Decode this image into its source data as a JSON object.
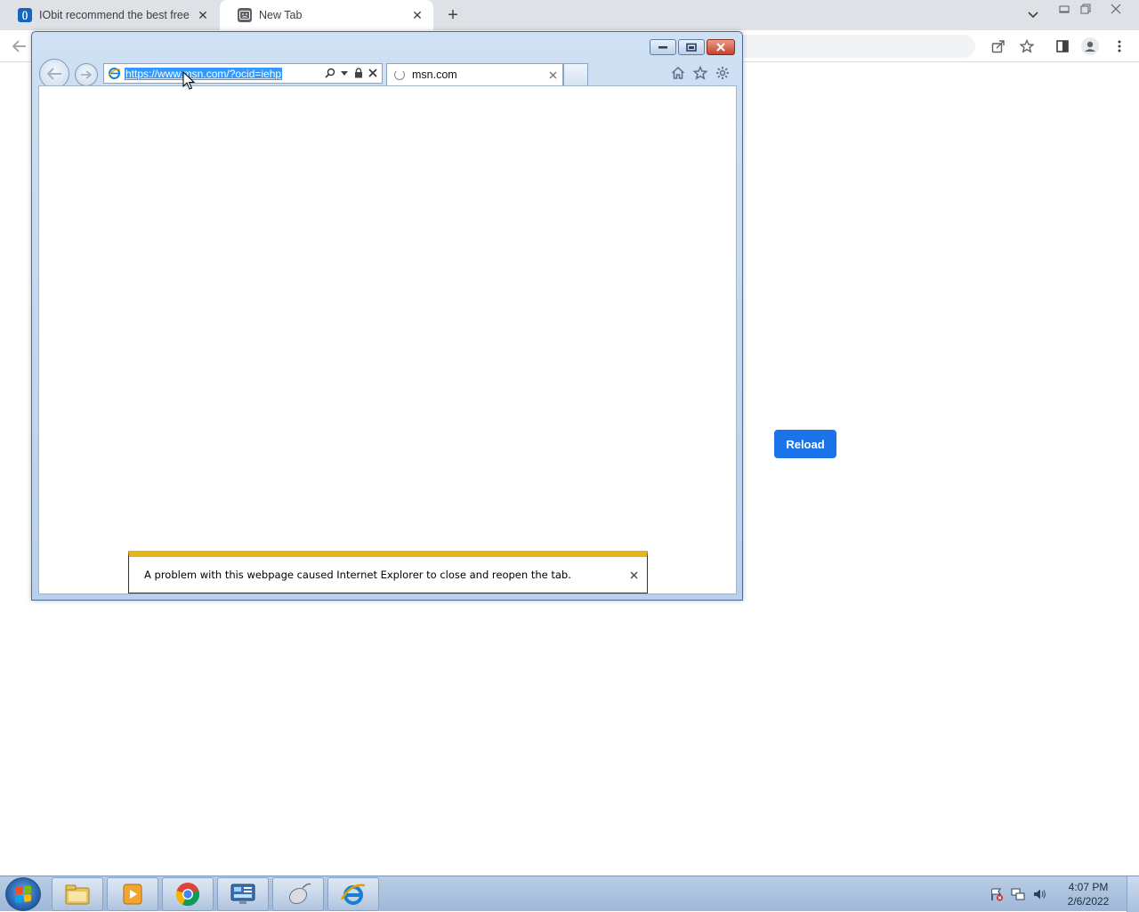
{
  "chrome": {
    "tabs": [
      {
        "title": "IObit recommend the best free, f",
        "active": false,
        "favicon": "iobit-icon"
      },
      {
        "title": "New Tab",
        "active": true,
        "favicon": "sad-tab-icon"
      }
    ],
    "new_tab_symbol": "+",
    "close_symbol": "✕"
  },
  "page": {
    "reload_label": "Reload",
    "accent": "#1a73e8"
  },
  "ie": {
    "url": "https://www.msn.com/?ocid=iehp",
    "tab_title": "msn.com",
    "notification_text": "A problem with this webpage caused Internet Explorer to close and reopen the tab.",
    "notification_accent": "#e6b41a"
  },
  "taskbar": {
    "apps": [
      "file-explorer-icon",
      "media-player-icon",
      "chrome-icon",
      "control-panel-icon",
      "mouse-icon",
      "internet-explorer-icon"
    ],
    "time": "4:07 PM",
    "date": "2/6/2022"
  }
}
